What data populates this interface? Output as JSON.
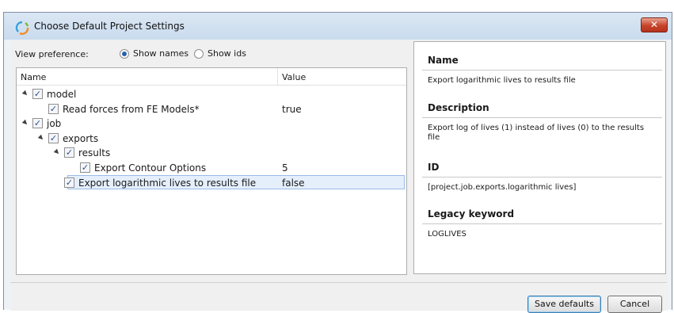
{
  "window": {
    "title": "Choose Default Project Settings",
    "close_glyph": "✕",
    "icon": "app-logo-icon"
  },
  "view_preference": {
    "label": "View preference:",
    "options": [
      {
        "label": "Show names",
        "selected": true
      },
      {
        "label": "Show ids",
        "selected": false
      }
    ]
  },
  "tree": {
    "columns": {
      "name": "Name",
      "value": "Value"
    },
    "rows": [
      {
        "label": "model",
        "value": "",
        "level": 0,
        "expandable": true,
        "checked": true,
        "selected": false
      },
      {
        "label": "Read forces from FE Models*",
        "value": "true",
        "level": 1,
        "expandable": false,
        "checked": true,
        "selected": false
      },
      {
        "label": "job",
        "value": "",
        "level": 0,
        "expandable": true,
        "checked": true,
        "selected": false
      },
      {
        "label": "exports",
        "value": "",
        "level": 1,
        "expandable": true,
        "checked": true,
        "selected": false
      },
      {
        "label": "results",
        "value": "",
        "level": 2,
        "expandable": true,
        "checked": true,
        "selected": false
      },
      {
        "label": "Export Contour Options",
        "value": "5",
        "level": 3,
        "expandable": false,
        "checked": true,
        "selected": false
      },
      {
        "label": "Export logarithmic lives to results file",
        "value": "false",
        "level": 2,
        "expandable": false,
        "checked": true,
        "selected": true
      }
    ]
  },
  "details": {
    "name_heading": "Name",
    "name_value": "Export logarithmic lives to results file",
    "description_heading": "Description",
    "description_value": "Export log of lives (1) instead of lives (0) to the results file",
    "id_heading": "ID",
    "id_value": "[project.job.exports.logarithmic lives]",
    "legacy_heading": "Legacy keyword",
    "legacy_value": "LOGLIVES"
  },
  "buttons": {
    "save_defaults": "Save defaults",
    "cancel": "Cancel"
  },
  "colors": {
    "selection_fill": "#e5effc",
    "selection_border": "#9bbbe8",
    "close_red": "#c8432b"
  }
}
